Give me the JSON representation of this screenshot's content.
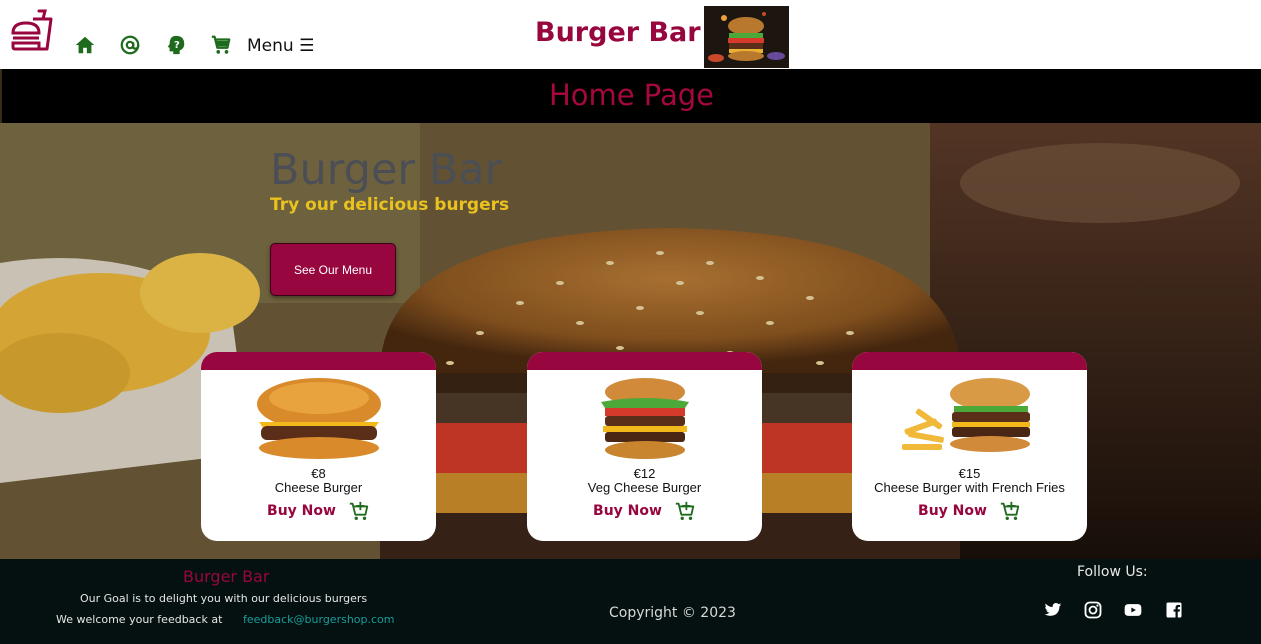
{
  "header": {
    "brand": "Burger Bar",
    "menu_label": "Menu ☰",
    "nav_icons": [
      "home-icon",
      "at-icon",
      "help-icon",
      "cart-icon"
    ]
  },
  "titlebar": {
    "title": "Home Page"
  },
  "hero": {
    "title": "Burger Bar",
    "subtitle": "Try our delicious burgers",
    "button_label": "See Our Menu"
  },
  "cards": [
    {
      "price": "€8",
      "name": "Cheese Burger",
      "buy_label": "Buy Now"
    },
    {
      "price": "€12",
      "name": "Veg Cheese Burger",
      "buy_label": "Buy Now"
    },
    {
      "price": "€15",
      "name": "Cheese Burger with French Fries",
      "buy_label": "Buy Now"
    }
  ],
  "footer": {
    "brand": "Burger Bar",
    "goal": "Our Goal is to delight you with our delicious burgers",
    "welcome": "We welcome your feedback at",
    "email": "feedback@burgershop.com",
    "copyright": "Copyright © 2023",
    "follow": "Follow Us:",
    "social": [
      "twitter-icon",
      "instagram-icon",
      "youtube-icon",
      "facebook-icon"
    ]
  },
  "colors": {
    "brand": "#98063f",
    "nav_icon": "#1e6b1e",
    "subtitle": "#e9c21f",
    "footer_bg": "#041110",
    "email_link": "#1a9c9c"
  }
}
